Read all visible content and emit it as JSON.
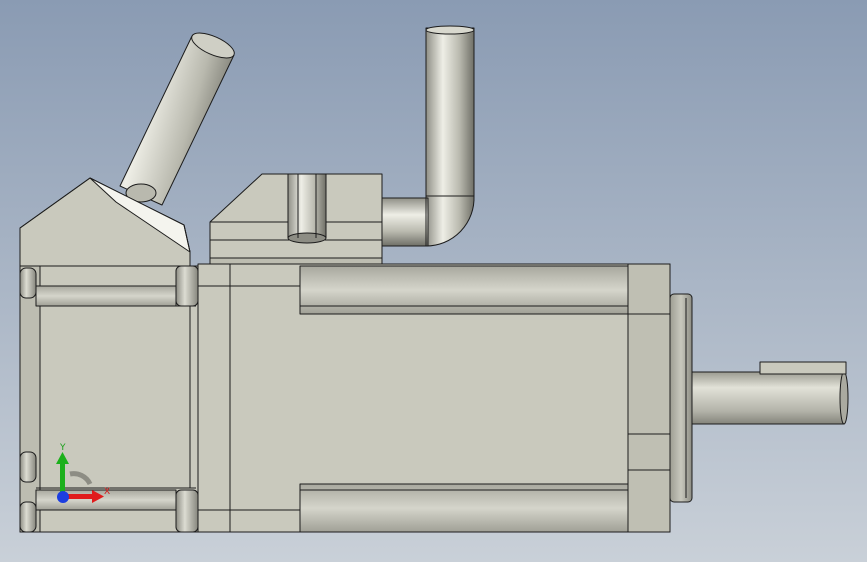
{
  "viewport": {
    "background_top": "#8a9bb3",
    "background_bottom": "#c9d0d8"
  },
  "model": {
    "body_color": "#c9c9bd",
    "edge_color": "#1c1c1c",
    "pipe_color": "#bcbcb2",
    "components": [
      "encoder-cap",
      "motor-housing",
      "connector-block",
      "output-shaft",
      "shaft-key",
      "angled-cable-pipe",
      "elbow-cable-pipe"
    ]
  },
  "triad": {
    "x_label": "X",
    "y_label": "Y",
    "x_color": "#e01c1c",
    "y_color": "#1cb01c",
    "z_color": "#1c3ee0"
  }
}
